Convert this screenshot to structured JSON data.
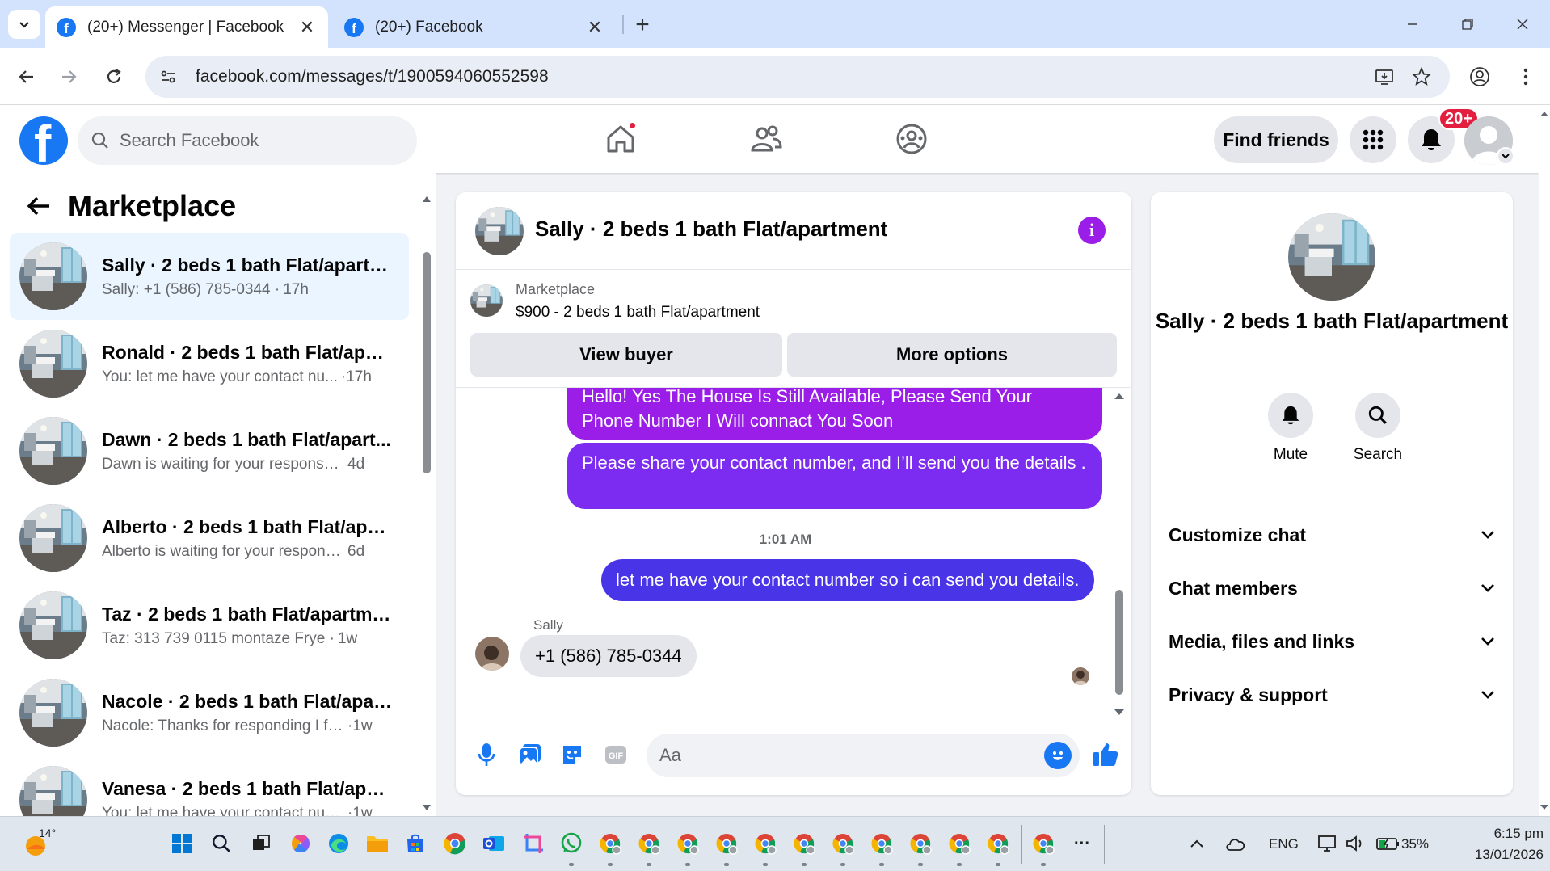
{
  "browser": {
    "tabs": [
      {
        "title": "(20+) Messenger | Facebook",
        "active": true
      },
      {
        "title": "(20+) Facebook",
        "active": false
      }
    ],
    "url": "facebook.com/messages/t/1900594060552598",
    "icons": [
      "back-icon",
      "forward-icon",
      "reload-icon",
      "site-info-icon",
      "install-app-icon",
      "bookmark-star-icon",
      "profile-icon",
      "kebab-menu-icon"
    ]
  },
  "fb_header": {
    "logo": "f",
    "search_placeholder": "Search Facebook",
    "find_friends": "Find friends",
    "notifications_badge": "20+",
    "nav_icons": [
      "home-icon",
      "friends-icon",
      "groups-icon"
    ]
  },
  "left_panel": {
    "title": "Marketplace",
    "conversations": [
      {
        "name": "Sally · 2 beds 1 bath Flat/apartm...",
        "preview": "Sally: +1 (586) 785-0344 ·",
        "time": "17h",
        "selected": true
      },
      {
        "name": "Ronald · 2 beds 1 bath Flat/apart...",
        "preview": "You: let me have your contact nu...",
        "time": "·17h",
        "selected": false
      },
      {
        "name": "Dawn · 2 beds 1 bath Flat/apart...",
        "preview": "Dawn is waiting for your response. ·",
        "time": "4d",
        "selected": false
      },
      {
        "name": "Alberto · 2 beds 1 bath Flat/apar...",
        "preview": "Alberto is waiting for your response. ·",
        "time": "6d",
        "selected": false
      },
      {
        "name": "Taz · 2 beds 1 bath Flat/apartment",
        "preview": "Taz: 313 739 0115 montaze Frye ·",
        "time": "1w",
        "selected": false
      },
      {
        "name": "Nacole · 2 beds 1 bath Flat/apart...",
        "preview": "Nacole: Thanks for responding I fo...",
        "time": "·1w",
        "selected": false
      },
      {
        "name": "Vanesa · 2 beds 1 bath Flat/apart...",
        "preview": "You: let me have your contact num...",
        "time": "·1w",
        "selected": false
      }
    ]
  },
  "chat": {
    "title": "Sally · 2 beds 1 bath Flat/apartment",
    "info_icon": "i",
    "listing_source": "Marketplace",
    "listing_title": "$900 - 2 beds 1 bath Flat/apartment",
    "view_buyer": "View buyer",
    "more_options": "More options",
    "messages": [
      {
        "text": "Hello! Yes The House  Is Still Available, Please Send Your Phone Number I Will connact You Soon",
        "from": "me"
      },
      {
        "text": "Please share your contact number, and I’ll send you the details .",
        "from": "me"
      },
      {
        "timestamp": "1:01 AM"
      },
      {
        "text": "let me have your contact number so i can send you details.",
        "from": "me"
      },
      {
        "sender": "Sally",
        "text": "+1 (586) 785-0344",
        "from": "them"
      }
    ],
    "composer_placeholder": "Aa",
    "colors": {
      "bubble_purple": "#9b1ee8",
      "bubble_violet": "#7b2cf0",
      "bubble_blue": "#4a34e8",
      "accent": "#1877f2"
    }
  },
  "info_panel": {
    "name": "Sally · 2 beds 1 bath Flat/apartment",
    "actions": [
      {
        "label": "Mute",
        "icon": "bell-icon"
      },
      {
        "label": "Search",
        "icon": "search-icon"
      }
    ],
    "sections": [
      "Customize chat",
      "Chat members",
      "Media, files and links",
      "Privacy & support"
    ]
  },
  "taskbar": {
    "weather_temp": "14°",
    "more": "···",
    "language": "ENG",
    "battery": "35%",
    "time": "6:15 pm",
    "date": "13/01/2026"
  }
}
